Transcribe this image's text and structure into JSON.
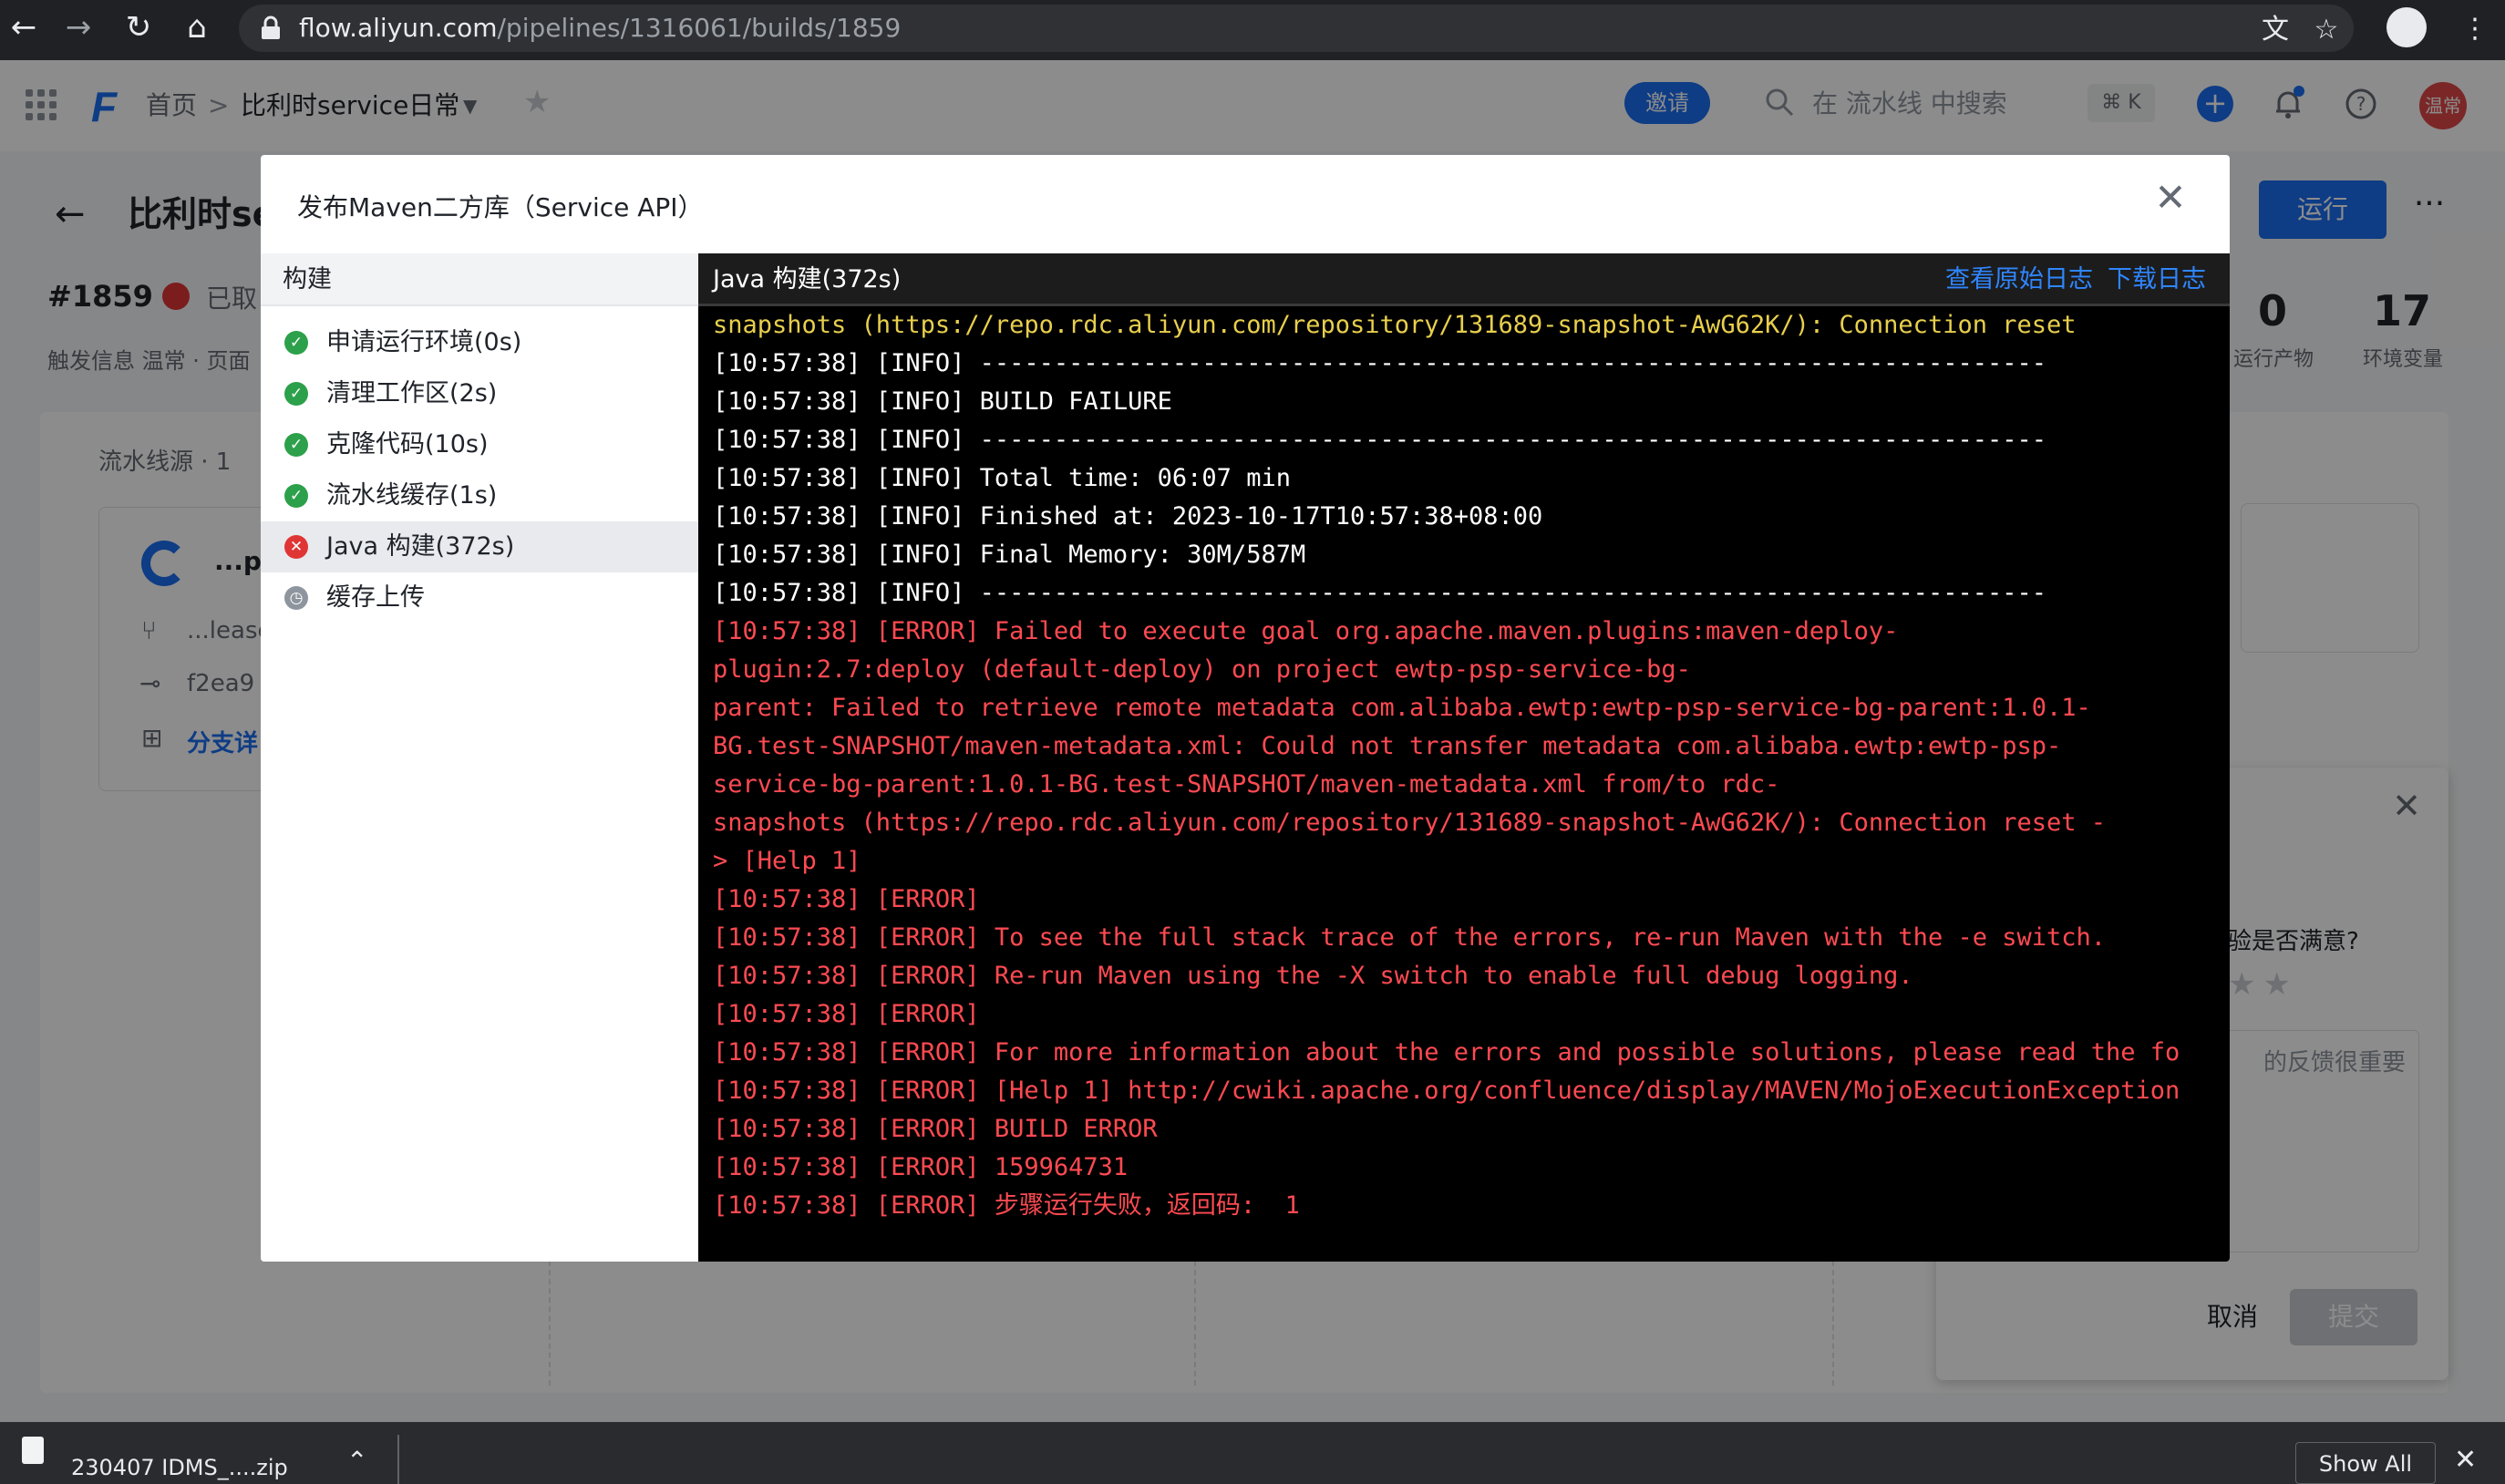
{
  "browser": {
    "url_domain": "flow.aliyun.com",
    "url_path": "/pipelines/1316061/builds/1859"
  },
  "header": {
    "home": "首页",
    "separator": ">",
    "project": "比利时service日常",
    "invite": "邀请",
    "search_placeholder": "在 流水线 中搜索",
    "shortcut": "⌘ K",
    "avatar_text": "温常"
  },
  "page": {
    "title": "比利时se",
    "run_button": "运行",
    "build_number": "#1859",
    "status_text": "已取",
    "trigger_info": "触发信息  温常  · 页面",
    "stats": [
      {
        "value": "0",
        "label": "运行产物"
      },
      {
        "value": "17",
        "label": "环境变量"
      }
    ],
    "source_label": "流水线源 · 1",
    "source_card": {
      "name": "...p-",
      "branch": "...lease",
      "commit": "f2ea9",
      "branch_link": "分支详"
    }
  },
  "feedback": {
    "question": "验是否满意?",
    "textarea_placeholder": "的反馈很重要",
    "cancel": "取消",
    "submit": "提交"
  },
  "modal": {
    "title": "发布Maven二方库（Service API）",
    "steps_header": "构建",
    "steps": [
      {
        "label": "申请运行环境(0s)",
        "status": "success"
      },
      {
        "label": "清理工作区(2s)",
        "status": "success"
      },
      {
        "label": "克隆代码(10s)",
        "status": "success"
      },
      {
        "label": "流水线缓存(1s)",
        "status": "success"
      },
      {
        "label": "Java 构建(372s)",
        "status": "failed"
      },
      {
        "label": "缓存上传",
        "status": "pending"
      }
    ],
    "log_title": "Java 构建(372s)",
    "view_raw_log": "查看原始日志",
    "download_log": "下载日志",
    "log_lines": [
      {
        "text": "snapshots (https://repo.rdc.aliyun.com/repository/131689-snapshot-AwG62K/): Connection reset",
        "level": "warn"
      },
      {
        "text": "[10:57:38] [INFO] ------------------------------------------------------------------------",
        "level": "info"
      },
      {
        "text": "[10:57:38] [INFO] BUILD FAILURE",
        "level": "info"
      },
      {
        "text": "[10:57:38] [INFO] ------------------------------------------------------------------------",
        "level": "info"
      },
      {
        "text": "[10:57:38] [INFO] Total time: 06:07 min",
        "level": "info"
      },
      {
        "text": "[10:57:38] [INFO] Finished at: 2023-10-17T10:57:38+08:00",
        "level": "info"
      },
      {
        "text": "[10:57:38] [INFO] Final Memory: 30M/587M",
        "level": "info"
      },
      {
        "text": "[10:57:38] [INFO] ------------------------------------------------------------------------",
        "level": "info"
      },
      {
        "text": "[10:57:38] [ERROR] Failed to execute goal org.apache.maven.plugins:maven-deploy-",
        "level": "error"
      },
      {
        "text": "plugin:2.7:deploy (default-deploy) on project ewtp-psp-service-bg-",
        "level": "error"
      },
      {
        "text": "parent: Failed to retrieve remote metadata com.alibaba.ewtp:ewtp-psp-service-bg-parent:1.0.1-",
        "level": "error"
      },
      {
        "text": "BG.test-SNAPSHOT/maven-metadata.xml: Could not transfer metadata com.alibaba.ewtp:ewtp-psp-",
        "level": "error"
      },
      {
        "text": "service-bg-parent:1.0.1-BG.test-SNAPSHOT/maven-metadata.xml from/to rdc-",
        "level": "error"
      },
      {
        "text": "snapshots (https://repo.rdc.aliyun.com/repository/131689-snapshot-AwG62K/): Connection reset -",
        "level": "error"
      },
      {
        "text": "> [Help 1]",
        "level": "error"
      },
      {
        "text": "[10:57:38] [ERROR]",
        "level": "error"
      },
      {
        "text": "[10:57:38] [ERROR] To see the full stack trace of the errors, re-run Maven with the -e switch.",
        "level": "error"
      },
      {
        "text": "[10:57:38] [ERROR] Re-run Maven using the -X switch to enable full debug logging.",
        "level": "error"
      },
      {
        "text": "[10:57:38] [ERROR]",
        "level": "error"
      },
      {
        "text": "[10:57:38] [ERROR] For more information about the errors and possible solutions, please read the fo",
        "level": "error"
      },
      {
        "text": "[10:57:38] [ERROR] [Help 1] http://cwiki.apache.org/confluence/display/MAVEN/MojoExecutionException",
        "level": "error"
      },
      {
        "text": "[10:57:38] [ERROR] BUILD ERROR",
        "level": "error"
      },
      {
        "text": "[10:57:38] [ERROR] 159964731",
        "level": "error"
      },
      {
        "text": "[10:57:38] [ERROR] 步骤运行失败，返回码:  1",
        "level": "error"
      }
    ]
  },
  "downloads": {
    "file_name": "230407 IDMS_....zip",
    "show_all": "Show All"
  },
  "colors": {
    "accent": "#1b6ef3",
    "success": "#2ca04a",
    "error": "#e03535",
    "log_error_text": "#ff4a52",
    "log_warn_text": "#e8cf4c"
  }
}
